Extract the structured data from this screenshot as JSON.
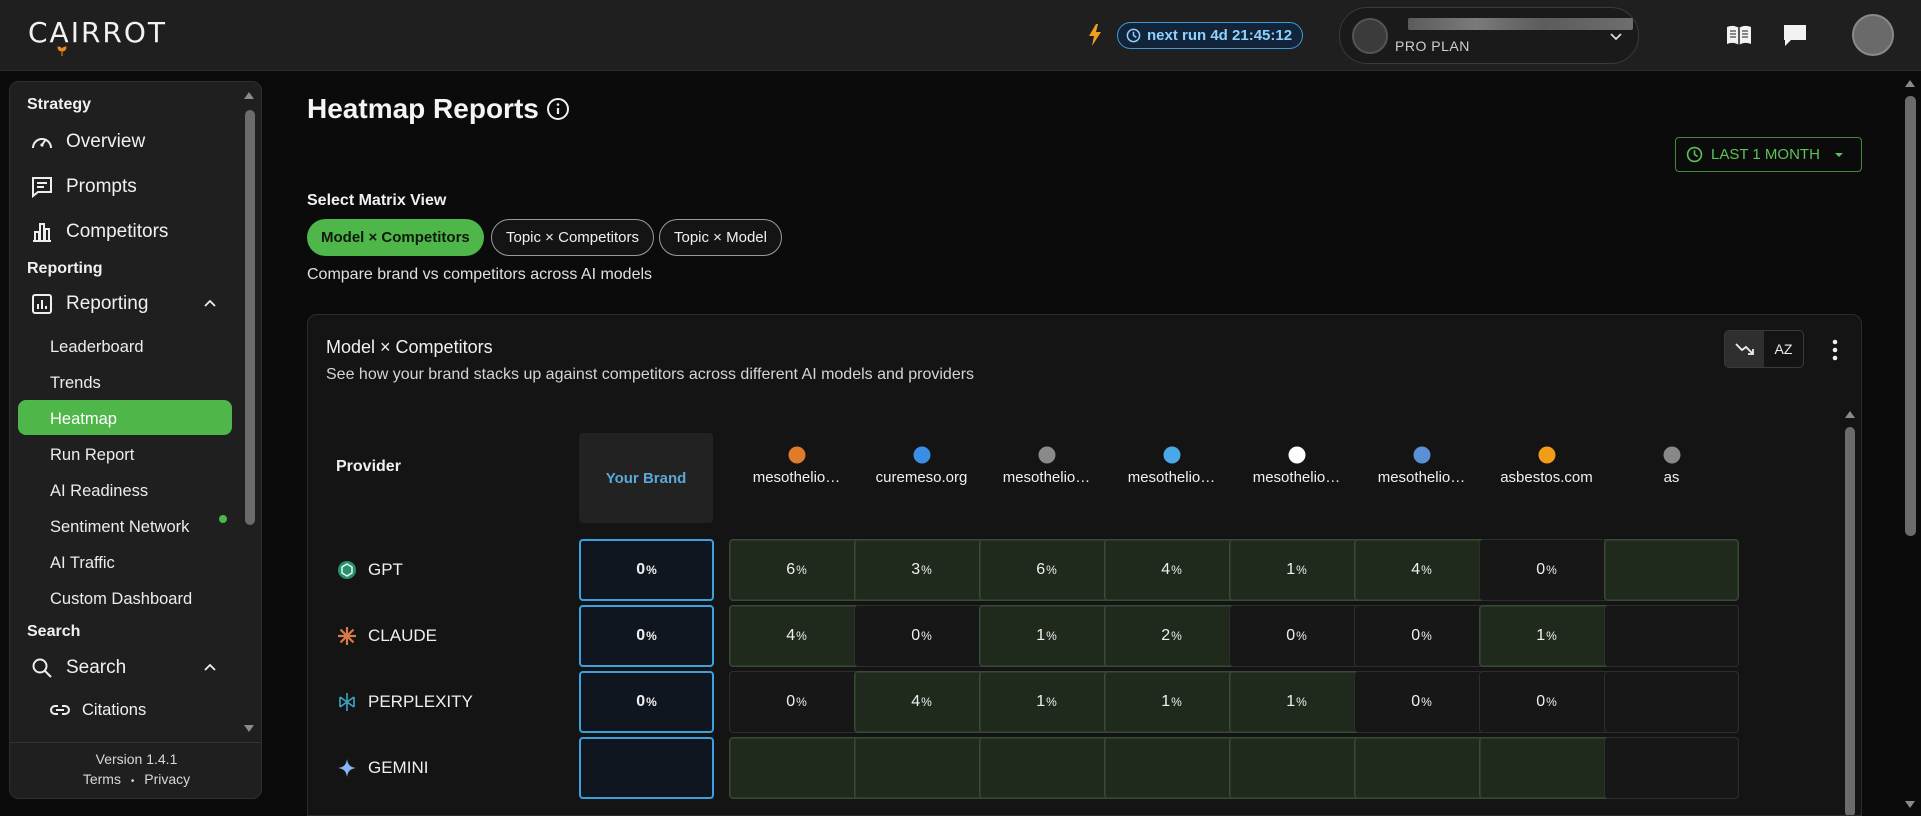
{
  "header": {
    "logo_text": "CAIRROT",
    "next_run": "next run 4d 21:45:12",
    "plan": "PRO PLAN"
  },
  "sidebar": {
    "sections": {
      "strategy": "Strategy",
      "reporting": "Reporting",
      "search": "Search"
    },
    "items": {
      "overview": "Overview",
      "prompts": "Prompts",
      "competitors": "Competitors",
      "reporting": "Reporting",
      "leaderboard": "Leaderboard",
      "trends": "Trends",
      "heatmap": "Heatmap",
      "run_report": "Run Report",
      "ai_readiness": "AI Readiness",
      "sentiment_network": "Sentiment Network",
      "ai_traffic": "AI Traffic",
      "custom_dashboard": "Custom Dashboard",
      "search": "Search",
      "citations": "Citations"
    },
    "active": "Heatmap",
    "footer": {
      "version": "Version 1.4.1",
      "terms": "Terms",
      "separator": "•",
      "privacy": "Privacy"
    }
  },
  "main": {
    "title": "Heatmap Reports",
    "range_button": "LAST 1 MONTH",
    "matrix_label": "Select Matrix View",
    "chips": [
      "Model × Competitors",
      "Topic × Competitors",
      "Topic × Model"
    ],
    "matrix_desc": "Compare brand vs competitors across AI models",
    "panel": {
      "title": "Model × Competitors",
      "subtitle": "See how your brand stacks up against competitors across different AI models and providers",
      "sort_az_label": "AZ",
      "provider_header": "Provider",
      "brand_header": "Your Brand",
      "competitors": [
        "mesothelio…",
        "curemeso.org",
        "mesothelio…",
        "mesothelio…",
        "mesothelio…",
        "mesothelio…",
        "asbestos.com",
        "as"
      ],
      "competitor_logo_colors": [
        "#e07b2a",
        "#3a8ee6",
        "#8a8a8a",
        "#4aa8e8",
        "#ffffff",
        "#5b8fd6",
        "#f39c1a",
        "#888888"
      ],
      "rows": [
        {
          "provider": "GPT",
          "icon": "openai-icon",
          "brand": "0",
          "values": [
            "6",
            "3",
            "6",
            "4",
            "1",
            "4",
            "0",
            ""
          ],
          "heat": [
            true,
            true,
            true,
            true,
            true,
            true,
            false,
            true
          ]
        },
        {
          "provider": "CLAUDE",
          "icon": "claude-icon",
          "brand": "0",
          "values": [
            "4",
            "0",
            "1",
            "2",
            "0",
            "0",
            "1",
            ""
          ],
          "heat": [
            true,
            false,
            true,
            true,
            false,
            false,
            true,
            false
          ]
        },
        {
          "provider": "PERPLEXITY",
          "icon": "perplexity-icon",
          "brand": "0",
          "values": [
            "0",
            "4",
            "1",
            "1",
            "1",
            "0",
            "0",
            ""
          ],
          "heat": [
            false,
            true,
            true,
            true,
            true,
            false,
            false,
            false
          ]
        },
        {
          "provider": "GEMINI",
          "icon": "gemini-icon",
          "brand": "",
          "values": [
            "",
            "",
            "",
            "",
            "",
            "",
            "",
            ""
          ],
          "heat": [
            true,
            true,
            true,
            true,
            true,
            true,
            true,
            false
          ]
        }
      ],
      "unit": "%"
    }
  }
}
